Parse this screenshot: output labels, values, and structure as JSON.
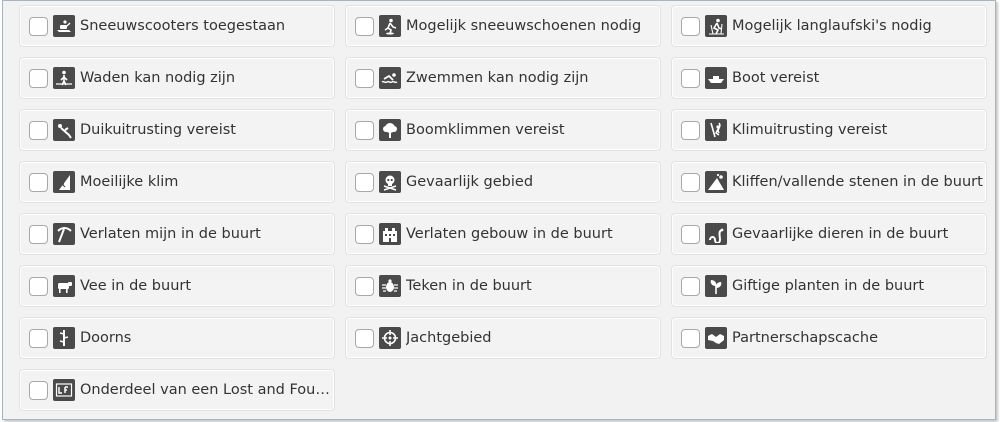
{
  "attributes": [
    {
      "label": "Sneeuwscooters toegestaan",
      "icon": "snowmobile-icon"
    },
    {
      "label": "Mogelijk sneeuwschoenen nodig",
      "icon": "snowshoe-icon"
    },
    {
      "label": "Mogelijk langlaufski's nodig",
      "icon": "cross-country-ski-icon"
    },
    {
      "label": "Waden kan nodig zijn",
      "icon": "wading-icon"
    },
    {
      "label": "Zwemmen kan nodig zijn",
      "icon": "swimming-icon"
    },
    {
      "label": "Boot vereist",
      "icon": "boat-icon"
    },
    {
      "label": "Duikuitrusting vereist",
      "icon": "scuba-icon"
    },
    {
      "label": "Boomklimmen vereist",
      "icon": "tree-icon"
    },
    {
      "label": "Klimuitrusting vereist",
      "icon": "climbing-gear-icon"
    },
    {
      "label": "Moeilijke klim",
      "icon": "difficult-climb-icon"
    },
    {
      "label": "Gevaarlijk gebied",
      "icon": "skull-icon"
    },
    {
      "label": "Kliffen/vallende stenen in de buurt",
      "icon": "falling-rocks-icon"
    },
    {
      "label": "Verlaten mijn in de buurt",
      "icon": "pickaxe-icon"
    },
    {
      "label": "Verlaten gebouw in de buurt",
      "icon": "building-icon"
    },
    {
      "label": "Gevaarlijke dieren in de buurt",
      "icon": "snake-icon"
    },
    {
      "label": "Vee in de buurt",
      "icon": "cow-icon"
    },
    {
      "label": "Teken in de buurt",
      "icon": "tick-icon"
    },
    {
      "label": "Giftige planten in de buurt",
      "icon": "poison-plant-icon"
    },
    {
      "label": "Doorns",
      "icon": "thorn-icon"
    },
    {
      "label": "Jachtgebied",
      "icon": "crosshair-icon"
    },
    {
      "label": "Partnerschapscache",
      "icon": "handshake-icon"
    },
    {
      "label": "Onderdeel van een Lost and Found ...",
      "icon": "lost-and-found-icon"
    }
  ],
  "colors": {
    "icon_bg": "#4a4a4a",
    "text": "#333333",
    "panel_bg": "#f2f2f2",
    "border": "#a9b4bf"
  }
}
